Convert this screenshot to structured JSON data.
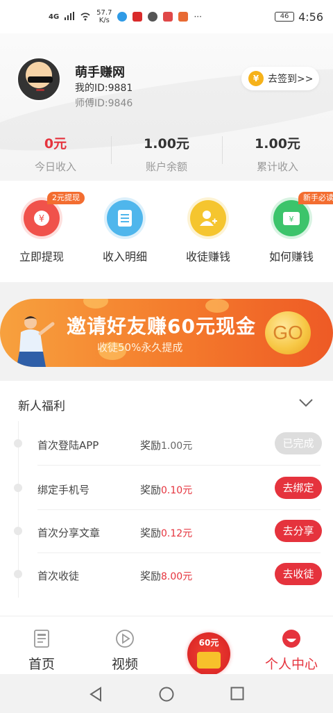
{
  "status_bar": {
    "signal": "4G",
    "speed_value": "57.7",
    "speed_unit": "K/s",
    "overflow": "···",
    "battery": "46",
    "time": "4:56"
  },
  "profile": {
    "nickname": "萌手赚网",
    "user_id": "我的ID:9881",
    "master_id": "师傅ID:9846",
    "checkin_label": "去签到>>",
    "coin_symbol": "¥"
  },
  "stats": [
    {
      "value": "0元",
      "label": "今日收入"
    },
    {
      "value": "1.00元",
      "label": "账户余额"
    },
    {
      "value": "1.00元",
      "label": "累计收入"
    }
  ],
  "actions": [
    {
      "label": "立即提现",
      "tag": "2元提现",
      "icon": "withdraw-icon",
      "color": "#f0524b"
    },
    {
      "label": "收入明细",
      "tag": "",
      "icon": "list-icon",
      "color": "#4fb6ec"
    },
    {
      "label": "收徒赚钱",
      "tag": "",
      "icon": "add-user-icon",
      "color": "#f5c52f"
    },
    {
      "label": "如何赚钱",
      "tag": "新手必读",
      "icon": "wallet-icon",
      "color": "#3cc46b"
    }
  ],
  "banner": {
    "title": "邀请好友赚60元现金",
    "subtitle": "收徒50%永久提成",
    "go": "GO"
  },
  "newbie": {
    "title": "新人福利",
    "reward_prefix": "奖励",
    "tasks": [
      {
        "name": "首次登陆APP",
        "reward": "1.00元",
        "button": "已完成",
        "done": true
      },
      {
        "name": "绑定手机号",
        "reward": "0.10元",
        "button": "去绑定",
        "done": false
      },
      {
        "name": "首次分享文章",
        "reward": "0.12元",
        "button": "去分享",
        "done": false
      },
      {
        "name": "首次收徒",
        "reward": "8.00元",
        "button": "去收徒",
        "done": false
      }
    ]
  },
  "bottom_nav": {
    "items": [
      {
        "label": "首页",
        "icon": "news-icon"
      },
      {
        "label": "视频",
        "icon": "play-icon"
      },
      {
        "label": "",
        "icon": "red-envelope-icon"
      },
      {
        "label": "个人中心",
        "icon": "profile-icon"
      }
    ],
    "center_badge": "60元",
    "active_color": "#e5333d"
  }
}
